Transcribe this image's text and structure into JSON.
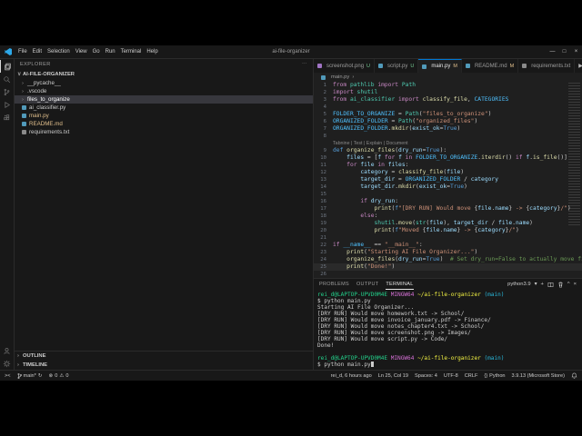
{
  "title_bar": {
    "menus": [
      "File",
      "Edit",
      "Selection",
      "View",
      "Go",
      "Run",
      "Terminal",
      "Help"
    ],
    "title": "ai-file-organizer",
    "window_controls": [
      "—",
      "□",
      "×"
    ]
  },
  "sidebar": {
    "header": "EXPLORER",
    "section": "AI-FILE-ORGANIZER",
    "items": [
      {
        "label": "__pycache__",
        "kind": "folder"
      },
      {
        "label": ".vscode",
        "kind": "folder"
      },
      {
        "label": "files_to_organize",
        "kind": "folder",
        "selected": true
      },
      {
        "label": "ai_classifier.py",
        "kind": "file",
        "icon_color": "#519aba"
      },
      {
        "label": "main.py",
        "kind": "file",
        "icon_color": "#519aba",
        "git": "modified"
      },
      {
        "label": "README.md",
        "kind": "file",
        "icon_color": "#519aba",
        "git": "modified"
      },
      {
        "label": "requirements.txt",
        "kind": "file",
        "icon_color": "#8a8a8a"
      }
    ],
    "bottom_sections": [
      "OUTLINE",
      "TIMELINE"
    ]
  },
  "editor": {
    "tabs": [
      {
        "label": "screenshot.png",
        "badge": "U",
        "icon_color": "#a074c4",
        "active": false
      },
      {
        "label": "script.py",
        "badge": "U",
        "icon_color": "#519aba",
        "active": false
      },
      {
        "label": "main.py",
        "badge": "M",
        "icon_color": "#519aba",
        "active": true
      },
      {
        "label": "README.md",
        "badge": "M",
        "icon_color": "#519aba",
        "active": false
      },
      {
        "label": "requirements.txt",
        "badge": "",
        "icon_color": "#8a8a8a",
        "active": false
      }
    ],
    "breadcrumb": "main.py",
    "code": {
      "active_line": 25,
      "codelens": "Tabnine | Test | Explain | Document",
      "lines": [
        {
          "n": 1,
          "tokens": [
            [
              "from ",
              "k"
            ],
            [
              "pathlib ",
              "t"
            ],
            [
              "import ",
              "k"
            ],
            [
              "Path",
              "t"
            ]
          ]
        },
        {
          "n": 2,
          "tokens": [
            [
              "import ",
              "k"
            ],
            [
              "shutil",
              "t"
            ]
          ]
        },
        {
          "n": 3,
          "tokens": [
            [
              "from ",
              "k"
            ],
            [
              "ai_classifier ",
              "t"
            ],
            [
              "import ",
              "k"
            ],
            [
              "classify_file",
              "f"
            ],
            [
              ", ",
              ""
            ],
            [
              "CATEGORIES",
              "c"
            ]
          ]
        },
        {
          "n": 4,
          "tokens": []
        },
        {
          "n": 5,
          "tokens": [
            [
              "FOLDER_TO_ORGANIZE",
              "c"
            ],
            [
              " = ",
              ""
            ],
            [
              "Path",
              "t"
            ],
            [
              "(",
              ""
            ],
            [
              "\"files_to_organize\"",
              "s"
            ],
            [
              ")",
              ""
            ]
          ]
        },
        {
          "n": 6,
          "tokens": [
            [
              "ORGANIZED_FOLDER",
              "c"
            ],
            [
              " = ",
              ""
            ],
            [
              "Path",
              "t"
            ],
            [
              "(",
              ""
            ],
            [
              "\"organized_files\"",
              "s"
            ],
            [
              ")",
              ""
            ]
          ]
        },
        {
          "n": 7,
          "tokens": [
            [
              "ORGANIZED_FOLDER",
              "c"
            ],
            [
              ".",
              ""
            ],
            [
              "mkdir",
              "f"
            ],
            [
              "(",
              ""
            ],
            [
              "exist_ok",
              "v"
            ],
            [
              "=",
              ""
            ],
            [
              "True",
              "b"
            ],
            [
              ")",
              ""
            ]
          ]
        },
        {
          "n": 8,
          "tokens": []
        },
        {
          "lens": true
        },
        {
          "n": 9,
          "tokens": [
            [
              "def ",
              "b"
            ],
            [
              "organize_files",
              "f"
            ],
            [
              "(",
              ""
            ],
            [
              "dry_run",
              "v"
            ],
            [
              "=",
              ""
            ],
            [
              "True",
              "b"
            ],
            [
              "):",
              ""
            ]
          ]
        },
        {
          "n": 10,
          "tokens": [
            [
              "    ",
              ""
            ],
            [
              "files",
              "v"
            ],
            [
              " = [",
              ""
            ],
            [
              "f ",
              "v"
            ],
            [
              "for ",
              "k"
            ],
            [
              "f ",
              "v"
            ],
            [
              "in ",
              "k"
            ],
            [
              "FOLDER_TO_ORGANIZE",
              "c"
            ],
            [
              ".",
              ""
            ],
            [
              "iterdir",
              "f"
            ],
            [
              "() ",
              ""
            ],
            [
              "if ",
              "k"
            ],
            [
              "f",
              "v"
            ],
            [
              ".",
              ""
            ],
            [
              "is_file",
              "f"
            ],
            [
              "()]",
              ""
            ]
          ]
        },
        {
          "n": 11,
          "tokens": [
            [
              "    ",
              ""
            ],
            [
              "for ",
              "k"
            ],
            [
              "file ",
              "v"
            ],
            [
              "in ",
              "k"
            ],
            [
              "files",
              "v"
            ],
            [
              ":",
              ""
            ]
          ]
        },
        {
          "n": 12,
          "tokens": [
            [
              "        ",
              ""
            ],
            [
              "category",
              "v"
            ],
            [
              " = ",
              ""
            ],
            [
              "classify_file",
              "f"
            ],
            [
              "(",
              ""
            ],
            [
              "file",
              "v"
            ],
            [
              ")",
              ""
            ]
          ]
        },
        {
          "n": 13,
          "tokens": [
            [
              "        ",
              ""
            ],
            [
              "target_dir",
              "v"
            ],
            [
              " = ",
              ""
            ],
            [
              "ORGANIZED_FOLDER",
              "c"
            ],
            [
              " / ",
              ""
            ],
            [
              "category",
              "v"
            ]
          ]
        },
        {
          "n": 14,
          "tokens": [
            [
              "        ",
              ""
            ],
            [
              "target_dir",
              "v"
            ],
            [
              ".",
              ""
            ],
            [
              "mkdir",
              "f"
            ],
            [
              "(",
              ""
            ],
            [
              "exist_ok",
              "v"
            ],
            [
              "=",
              ""
            ],
            [
              "True",
              "b"
            ],
            [
              ")",
              ""
            ]
          ]
        },
        {
          "n": 15,
          "tokens": []
        },
        {
          "n": 16,
          "tokens": [
            [
              "        ",
              ""
            ],
            [
              "if ",
              "k"
            ],
            [
              "dry_run",
              "v"
            ],
            [
              ":",
              ""
            ]
          ]
        },
        {
          "n": 17,
          "tokens": [
            [
              "            ",
              ""
            ],
            [
              "print",
              "f"
            ],
            [
              "(",
              ""
            ],
            [
              "f",
              "b"
            ],
            [
              "\"[DRY RUN] Would move ",
              "s"
            ],
            [
              "{",
              ""
            ],
            [
              "file",
              "v"
            ],
            [
              ".",
              ""
            ],
            [
              "name",
              "v"
            ],
            [
              "}",
              ""
            ],
            [
              " -> ",
              "s"
            ],
            [
              "{",
              ""
            ],
            [
              "category",
              "v"
            ],
            [
              "}",
              ""
            ],
            [
              "/\"",
              "s"
            ],
            [
              ")",
              ""
            ]
          ]
        },
        {
          "n": 18,
          "tokens": [
            [
              "        ",
              ""
            ],
            [
              "else",
              "k"
            ],
            [
              ":",
              ""
            ]
          ]
        },
        {
          "n": 19,
          "tokens": [
            [
              "            ",
              ""
            ],
            [
              "shutil",
              "t"
            ],
            [
              ".",
              ""
            ],
            [
              "move",
              "f"
            ],
            [
              "(",
              ""
            ],
            [
              "str",
              "t"
            ],
            [
              "(",
              ""
            ],
            [
              "file",
              "v"
            ],
            [
              "), ",
              ""
            ],
            [
              "target_dir",
              "v"
            ],
            [
              " / ",
              ""
            ],
            [
              "file",
              "v"
            ],
            [
              ".",
              ""
            ],
            [
              "name",
              "v"
            ],
            [
              ")",
              ""
            ]
          ]
        },
        {
          "n": 20,
          "tokens": [
            [
              "            ",
              ""
            ],
            [
              "print",
              "f"
            ],
            [
              "(",
              ""
            ],
            [
              "f",
              "b"
            ],
            [
              "\"Moved ",
              "s"
            ],
            [
              "{",
              ""
            ],
            [
              "file",
              "v"
            ],
            [
              ".",
              ""
            ],
            [
              "name",
              "v"
            ],
            [
              "}",
              ""
            ],
            [
              " -> ",
              "s"
            ],
            [
              "{",
              ""
            ],
            [
              "category",
              "v"
            ],
            [
              "}",
              ""
            ],
            [
              "/\"",
              "s"
            ],
            [
              ")",
              ""
            ]
          ]
        },
        {
          "n": 21,
          "tokens": []
        },
        {
          "n": 22,
          "tokens": [
            [
              "if ",
              "k"
            ],
            [
              "__name__",
              "c"
            ],
            [
              " == ",
              ""
            ],
            [
              "\"__main__\"",
              "s"
            ],
            [
              ":",
              ""
            ]
          ]
        },
        {
          "n": 23,
          "tokens": [
            [
              "    ",
              ""
            ],
            [
              "print",
              "f"
            ],
            [
              "(",
              ""
            ],
            [
              "\"Starting AI File Organizer...\"",
              "s"
            ],
            [
              ")",
              ""
            ]
          ]
        },
        {
          "n": 24,
          "tokens": [
            [
              "    ",
              ""
            ],
            [
              "organize_files",
              "f"
            ],
            [
              "(",
              ""
            ],
            [
              "dry_run",
              "v"
            ],
            [
              "=",
              ""
            ],
            [
              "True",
              "b"
            ],
            [
              ")  ",
              ""
            ],
            [
              "# Set dry_run=False to actually move files",
              "m"
            ]
          ]
        },
        {
          "n": 25,
          "tokens": [
            [
              "    ",
              ""
            ],
            [
              "print",
              "f"
            ],
            [
              "(",
              ""
            ],
            [
              "\"Done!\"",
              "s"
            ],
            [
              ")",
              ""
            ]
          ]
        },
        {
          "n": 26,
          "tokens": []
        }
      ]
    }
  },
  "panel": {
    "tabs": [
      "PROBLEMS",
      "OUTPUT",
      "TERMINAL"
    ],
    "active_tab": "TERMINAL",
    "shell_label": "python3.9",
    "terminal_lines": [
      [
        [
          "rei_d@LAPTOP-UPVD0M4E ",
          "g"
        ],
        [
          "MINGW64 ",
          "p"
        ],
        [
          "~/ai-file-organizer ",
          "y"
        ],
        [
          "(main)",
          "cy"
        ]
      ],
      [
        [
          "$ python main.py",
          ""
        ]
      ],
      [
        [
          "Starting AI File Organizer...",
          ""
        ]
      ],
      [
        [
          "[DRY RUN] Would move homework.txt -> School/",
          ""
        ]
      ],
      [
        [
          "[DRY RUN] Would move invoice_january.pdf -> Finance/",
          ""
        ]
      ],
      [
        [
          "[DRY RUN] Would move notes_chapter4.txt -> School/",
          ""
        ]
      ],
      [
        [
          "[DRY RUN] Would move screenshot.png -> Images/",
          ""
        ]
      ],
      [
        [
          "[DRY RUN] Would move script.py -> Code/",
          ""
        ]
      ],
      [
        [
          "Done!",
          ""
        ]
      ],
      [],
      [
        [
          "rei_d@LAPTOP-UPVD0M4E ",
          "g"
        ],
        [
          "MINGW64 ",
          "p"
        ],
        [
          "~/ai-file-organizer ",
          "y"
        ],
        [
          "(main)",
          "cy"
        ]
      ],
      [
        [
          "$ python main.py",
          ""
        ],
        [
          "",
          "cur"
        ]
      ]
    ]
  },
  "status_bar": {
    "remote": "><",
    "branch": "main*",
    "errors": "0",
    "warnings": "0",
    "right": [
      {
        "name": "git-blame",
        "label": "rei_d, 6 hours ago"
      },
      {
        "name": "cursor-position",
        "label": "Ln 25, Col 19"
      },
      {
        "name": "indentation",
        "label": "Spaces: 4"
      },
      {
        "name": "encoding",
        "label": "UTF-8"
      },
      {
        "name": "eol",
        "label": "CRLF"
      },
      {
        "name": "language-mode",
        "label": "Python",
        "icon": "{}"
      },
      {
        "name": "python-interpreter",
        "label": "3.9.13 (Microsoft Store)"
      }
    ]
  },
  "icons": {
    "more": "⋯",
    "chevron_down": "∨",
    "chevron_right": "›",
    "run": "▶",
    "caret_down": "▾",
    "plus": "+",
    "close": "×",
    "chevron_up": "^",
    "sync": "↻",
    "error": "⊗",
    "warning": "⚠",
    "braces": "{}"
  },
  "colors": {
    "accent": "#0078d4",
    "git_modified": "#e2c08d",
    "git_untracked": "#73c991"
  }
}
